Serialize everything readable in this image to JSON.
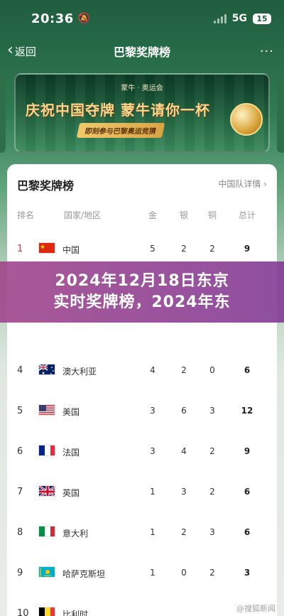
{
  "status_bar": {
    "time": "20:36",
    "network": "5G",
    "battery": "15"
  },
  "nav": {
    "back_label": "返回",
    "title": "巴黎奖牌榜",
    "more": "···"
  },
  "banner": {
    "logo": "蒙牛 · 奥运会",
    "headline": "庆祝中国夺牌  蒙牛请你一杯",
    "subline": "即刻参与巴黎奥运竞猜"
  },
  "card": {
    "title": "巴黎奖牌榜",
    "detail_link": "中国队详情 ›",
    "headers": {
      "rank": "排名",
      "country": "国家/地区",
      "gold": "金",
      "silver": "银",
      "bronze": "铜",
      "total": "总计"
    },
    "rows": [
      {
        "rank": "1",
        "country": "中国",
        "gold": "5",
        "silver": "2",
        "bronze": "2",
        "total": "9"
      },
      {
        "rank": "4",
        "country": "澳大利亚",
        "gold": "4",
        "silver": "2",
        "bronze": "0",
        "total": "6"
      },
      {
        "rank": "5",
        "country": "美国",
        "gold": "3",
        "silver": "6",
        "bronze": "3",
        "total": "12"
      },
      {
        "rank": "6",
        "country": "法国",
        "gold": "3",
        "silver": "4",
        "bronze": "2",
        "total": "9"
      },
      {
        "rank": "7",
        "country": "英国",
        "gold": "1",
        "silver": "3",
        "bronze": "2",
        "total": "6"
      },
      {
        "rank": "8",
        "country": "意大利",
        "gold": "1",
        "silver": "2",
        "bronze": "3",
        "total": "6"
      },
      {
        "rank": "9",
        "country": "哈萨克斯坦",
        "gold": "1",
        "silver": "0",
        "bronze": "2",
        "total": "3"
      },
      {
        "rank": "10",
        "country": "比利时",
        "gold": "",
        "silver": "",
        "bronze": "",
        "total": ""
      }
    ]
  },
  "overlay": {
    "line1": "2024年12月18日东京",
    "line2": "实时奖牌榜，2024年东"
  },
  "watermark": "@搜狐新闻",
  "colors": {
    "accent_green": "#1f5d3f",
    "rank_top": "#d9363e",
    "overlay": "#9a4a9a"
  }
}
